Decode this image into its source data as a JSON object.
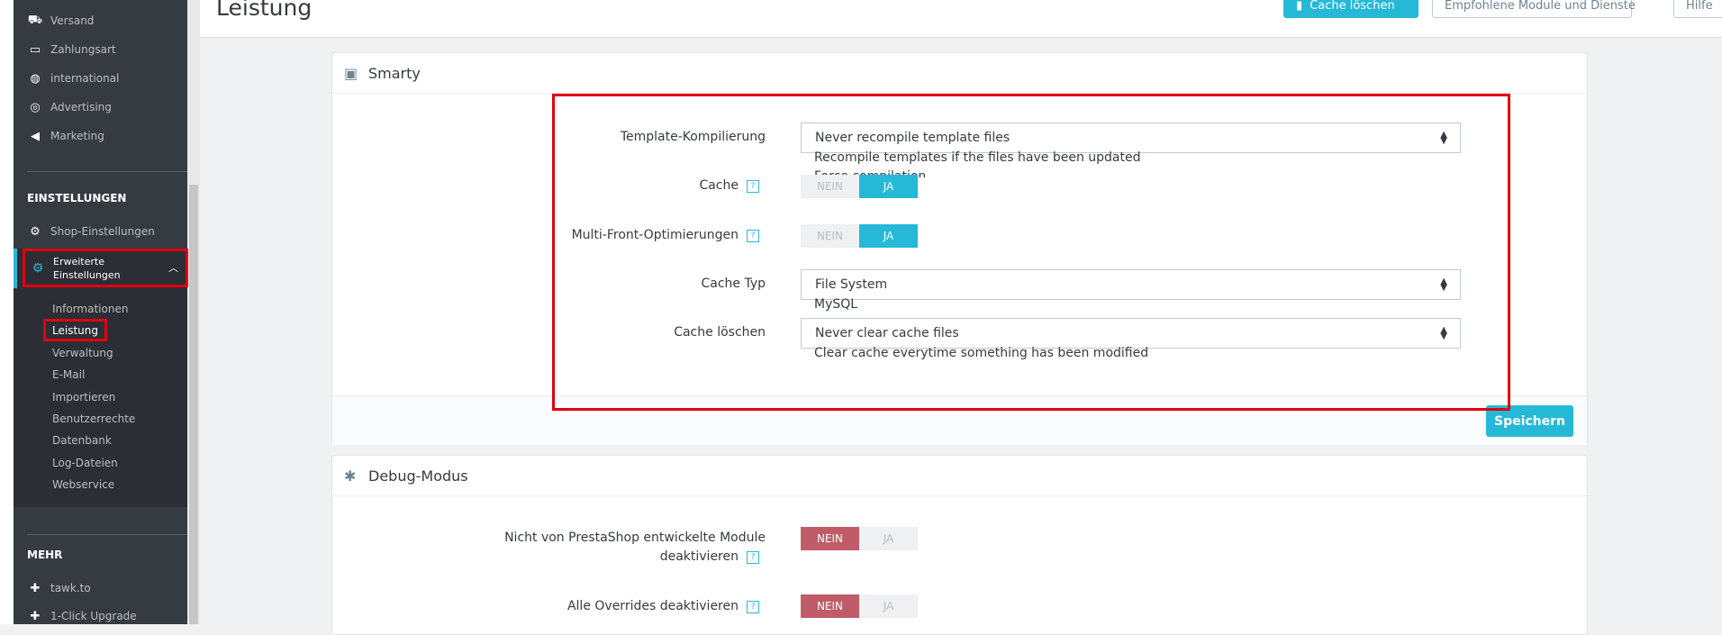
{
  "sidebar": {
    "items_top": [
      {
        "label": "Versand",
        "icon": "truck-icon"
      },
      {
        "label": "Zahlungsart",
        "icon": "credit-card-icon"
      },
      {
        "label": "international",
        "icon": "globe-icon"
      },
      {
        "label": "Advertising",
        "icon": "target-icon"
      },
      {
        "label": "Marketing",
        "icon": "megaphone-icon"
      }
    ],
    "section_settings": "EINSTELLUNGEN",
    "shop_settings": "Shop-Einstellungen",
    "advanced_settings": "Erweiterte Einstellungen",
    "sub_items": [
      "Informationen",
      "Leistung",
      "Verwaltung",
      "E-Mail",
      "Importieren",
      "Benutzerrechte",
      "Datenbank",
      "Log-Dateien",
      "Webservice"
    ],
    "section_more": "MEHR",
    "more_items": [
      {
        "label": "tawk.to",
        "icon": "puzzle-icon"
      },
      {
        "label": "1-Click Upgrade",
        "icon": "puzzle-icon"
      }
    ]
  },
  "header": {
    "title": "Leistung",
    "clear_cache": "Cache löschen",
    "recommended": "Empfohlene Module und Dienste",
    "help": "Hilfe"
  },
  "smarty": {
    "title": "Smarty",
    "template_label": "Template-Kompilierung",
    "template_value": "Never recompile template files",
    "template_opt2": "Recompile templates if the files have been updated",
    "template_opt3": "Force compilation",
    "cache_label": "Cache",
    "multi_front_label": "Multi-Front-Optimierungen",
    "cache_type_label": "Cache Typ",
    "cache_type_value": "File System",
    "cache_type_opt2": "MySQL",
    "clear_cache_label": "Cache löschen",
    "clear_cache_value": "Never clear cache files",
    "clear_cache_opt2": "Clear cache everytime something has been modified",
    "no": "NEIN",
    "yes": "JA",
    "help": "?",
    "save": "Speichern"
  },
  "debug": {
    "title": "Debug-Modus",
    "non_presta_label_1": "Nicht von PrestaShop entwickelte Module",
    "non_presta_label_2": "deaktivieren",
    "overrides_label": "Alle Overrides deaktivieren",
    "no": "NEIN",
    "yes": "JA",
    "help": "?"
  },
  "colors": {
    "accent": "#25b9d7",
    "danger": "#c05c67",
    "highlight": "#e1000f",
    "sidebar": "#363a41"
  }
}
